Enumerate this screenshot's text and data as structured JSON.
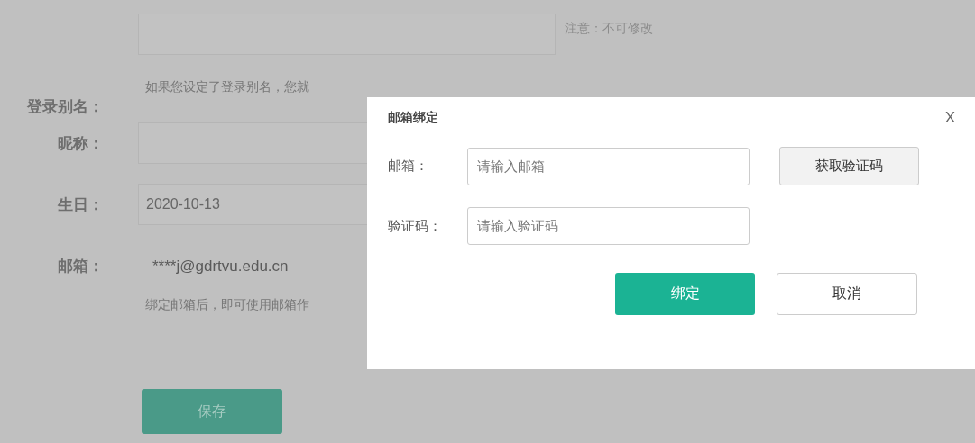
{
  "form": {
    "fields": [
      {
        "kind": "input",
        "label": "登录别名：",
        "note": "注意：不可修改",
        "hint": "如果您设定了登录别名，您就"
      },
      {
        "kind": "input",
        "label": "昵称："
      },
      {
        "kind": "input",
        "label": "生日：",
        "value": "2020-10-13"
      },
      {
        "kind": "text",
        "label": "邮箱：",
        "value": "****j@gdrtvu.edu.cn",
        "hint": "绑定邮箱后，即可使用邮箱作"
      }
    ],
    "save_button": "保存"
  },
  "dialog": {
    "title": "邮箱绑定",
    "close": "X",
    "fields": [
      {
        "label": "邮箱：",
        "placeholder": "请输入邮箱",
        "button": "获取验证码"
      },
      {
        "label": "验证码：",
        "placeholder": "请输入验证码"
      }
    ],
    "buttons": [
      {
        "label": "绑定",
        "kind": "primary"
      },
      {
        "label": "取消",
        "kind": "secondary"
      }
    ]
  }
}
